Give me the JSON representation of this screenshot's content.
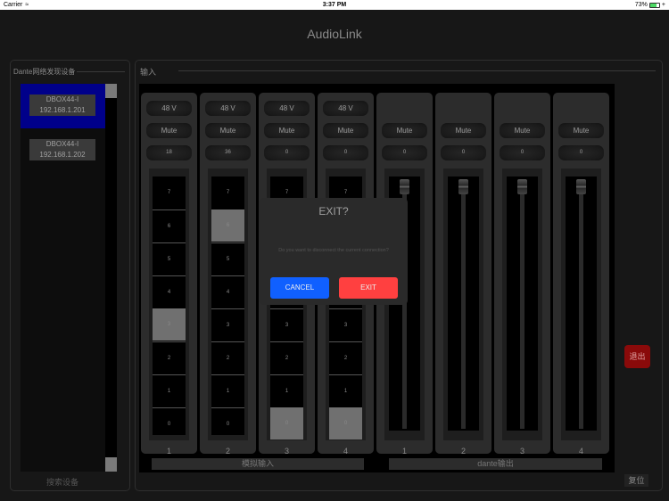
{
  "status_bar": {
    "carrier": "Carrier",
    "time": "3:37 PM",
    "battery": "73%",
    "battery_level": 0.73
  },
  "app_title": "AudioLink",
  "left_panel": {
    "title": "Dante网络发现设备",
    "devices": [
      {
        "name": "DBOX44-I",
        "ip": "192.168.1.201",
        "selected": true
      },
      {
        "name": "DBOX44-I",
        "ip": "192.168.1.202",
        "selected": false
      }
    ],
    "search_label": "搜索设备"
  },
  "right_panel": {
    "title": "输入",
    "inputs": [
      {
        "phantom": "48 V",
        "mute": "Mute",
        "gain": "18",
        "level": 3,
        "number": "1"
      },
      {
        "phantom": "48 V",
        "mute": "Mute",
        "gain": "36",
        "level": 6,
        "number": "2"
      },
      {
        "phantom": "48 V",
        "mute": "Mute",
        "gain": "0",
        "level": 0,
        "number": "3"
      },
      {
        "phantom": "48 V",
        "mute": "Mute",
        "gain": "0",
        "level": 0,
        "number": "4"
      }
    ],
    "outputs": [
      {
        "mute": "Mute",
        "gain": "0",
        "fader": 1.0,
        "number": "1"
      },
      {
        "mute": "Mute",
        "gain": "0",
        "fader": 1.0,
        "number": "2"
      },
      {
        "mute": "Mute",
        "gain": "0",
        "fader": 1.0,
        "number": "3"
      },
      {
        "mute": "Mute",
        "gain": "0",
        "fader": 1.0,
        "number": "4"
      }
    ],
    "meter_steps": [
      "7",
      "6",
      "5",
      "4",
      "3",
      "2",
      "1",
      "0"
    ],
    "analog_input_label": "模拟输入",
    "dante_output_label": "dante输出",
    "exit_label": "退出",
    "reset_label": "复位"
  },
  "dialog": {
    "title": "EXIT?",
    "message": "Do you want to disconnect the current connection?",
    "cancel_label": "CANCEL",
    "exit_label": "EXIT",
    "colors": {
      "cancel": "#1060ff",
      "exit": "#ff4040"
    }
  }
}
